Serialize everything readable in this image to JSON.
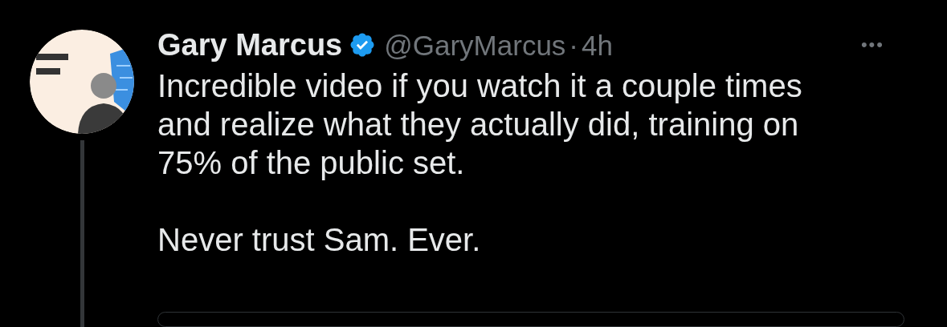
{
  "tweet": {
    "author": {
      "name": "Gary Marcus",
      "verified": true,
      "handle": "@GaryMarcus",
      "separator": "·",
      "time": "4h"
    },
    "more": "•••",
    "body": "Incredible video if you watch it a couple times and realize what they actually did, training on 75% of the public set.\n\nNever trust Sam. Ever."
  }
}
